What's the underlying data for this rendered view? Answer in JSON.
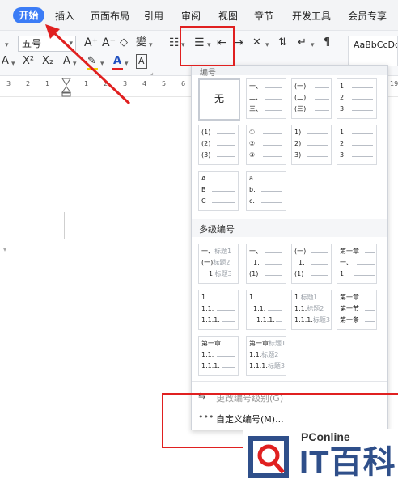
{
  "tabs": {
    "home": "开始",
    "insert": "插入",
    "page_layout": "页面布局",
    "references": "引用",
    "review": "审阅",
    "view": "视图",
    "chapter": "章节",
    "developer": "开发工具",
    "member": "会员专享"
  },
  "ribbon": {
    "font_size": "五号",
    "grow_font": "A⁺",
    "shrink_font": "A⁻",
    "pinyin": "變",
    "superscript": "X²",
    "subscript": "X₂",
    "font_color": "A",
    "char_border": "A",
    "style_preview": "AaBbCcDd"
  },
  "ruler": {
    "numbers": [
      "3",
      "2",
      "1",
      "1",
      "2",
      "3",
      "4",
      "5",
      "6",
      "19"
    ]
  },
  "numbering_panel": {
    "title": "编号",
    "none_label": "无",
    "basic_tiles": [
      [
        "一、",
        "二、",
        "三、"
      ],
      [
        "(一)",
        "(二)",
        "(三)"
      ],
      [
        "1.",
        "2.",
        "3."
      ],
      [
        "(1)",
        "(2)",
        "(3)"
      ],
      [
        "①",
        "②",
        "③"
      ],
      [
        "1)",
        "2)",
        "3)"
      ],
      [
        "1.",
        "2.",
        "3."
      ],
      [
        "A",
        "B",
        "C"
      ],
      [
        "a.",
        "b.",
        "c."
      ]
    ],
    "multilevel_title": "多级编号",
    "multilevel_tiles": [
      {
        "lines": [
          "一、",
          "(一)",
          "1."
        ],
        "headings": [
          "标题1",
          "标题2",
          "标题3"
        ]
      },
      {
        "lines": [
          "一、",
          "1.",
          "(1)"
        ],
        "headings": [
          "",
          "",
          ""
        ]
      },
      {
        "lines": [
          "(一)",
          "1.",
          "(1)"
        ],
        "headings": [
          "",
          "",
          ""
        ]
      },
      {
        "lines": [
          "第一章",
          "一、",
          "1."
        ],
        "headings": [
          "",
          "",
          ""
        ]
      },
      {
        "lines": [
          "1.",
          "1.1.",
          "1.1.1."
        ],
        "headings": [
          "",
          "",
          ""
        ]
      },
      {
        "lines": [
          "1.",
          "1.1.",
          "1.1.1."
        ],
        "headings": [
          "",
          "",
          ""
        ]
      },
      {
        "lines": [
          "1.",
          "1.1.",
          "1.1.1."
        ],
        "headings": [
          "标题1",
          "标题2",
          "标题3"
        ]
      },
      {
        "lines": [
          "第一章",
          "第一节",
          "第一条"
        ],
        "headings": [
          "",
          "",
          ""
        ]
      },
      {
        "lines": [
          "第一章",
          "1.1.",
          "1.1.1."
        ],
        "headings": [
          "",
          "",
          ""
        ]
      },
      {
        "lines": [
          "第一章",
          "1.1.",
          "1.1.1."
        ],
        "headings": [
          "标题1",
          "标题2",
          "标题3"
        ]
      }
    ],
    "change_level_label": "更改编号级别(G)",
    "custom_numbering_label": "自定义编号(M)..."
  },
  "watermark": {
    "site": "PConline",
    "brand": "IT百科"
  },
  "colors": {
    "accent": "#3b7cf6",
    "annotation": "#e02020",
    "highlight_yellow": "#f5d000",
    "font_red": "#e02020",
    "brand_blue": "#2f4f8a"
  }
}
